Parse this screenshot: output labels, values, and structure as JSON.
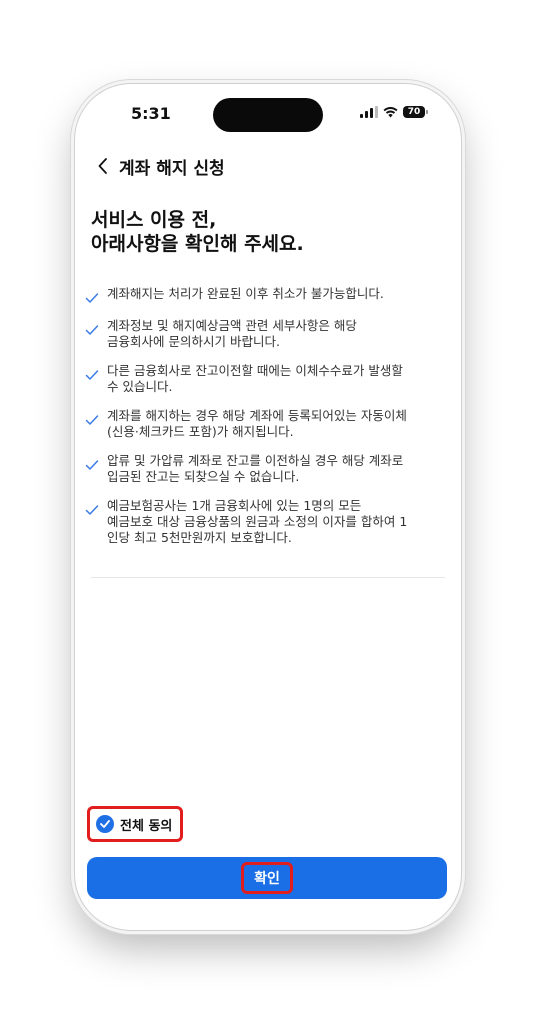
{
  "status_bar": {
    "time": "5:31",
    "battery_level": "70",
    "icons": [
      "signal-icon",
      "wifi-icon",
      "battery-icon"
    ]
  },
  "nav": {
    "back_icon": "chevron-left-icon",
    "title": "계좌 해지 신청"
  },
  "heading": {
    "line1": "서비스 이용 전,",
    "line2": "아래사항을 확인해 주세요."
  },
  "notices": [
    {
      "lines": [
        "계좌해지는 처리가 완료된 이후 취소가 불가능합니다."
      ]
    },
    {
      "lines": [
        "계좌정보 및 해지예상금액 관련 세부사항은 해당",
        "금융회사에 문의하시기 바랍니다."
      ]
    },
    {
      "lines": [
        "다른 금융회사로 잔고이전할 때에는 이체수수료가 발생할",
        "수 있습니다."
      ]
    },
    {
      "lines": [
        "계좌를 해지하는 경우 해당 계좌에 등록되어있는 자동이체",
        "(신용·체크카드 포함)가 해지됩니다."
      ]
    },
    {
      "lines": [
        "압류 및 가압류 계좌로 잔고를 이전하실 경우 해당 계좌로",
        "입금된 잔고는 되찾으실 수 없습니다."
      ]
    },
    {
      "lines": [
        "예금보험공사는 1개 금융회사에 있는 1명의 모든",
        "예금보호 대상 금융상품의 원금과 소정의 이자를 합하여 1",
        "인당 최고 5천만원까지 보호합니다."
      ]
    }
  ],
  "agree": {
    "label": "전체 동의",
    "checked": true
  },
  "confirm": {
    "label": "확인"
  },
  "colors": {
    "accent": "#1a6ee6",
    "highlight": "#e11d1d",
    "check": "#3b7be8"
  }
}
